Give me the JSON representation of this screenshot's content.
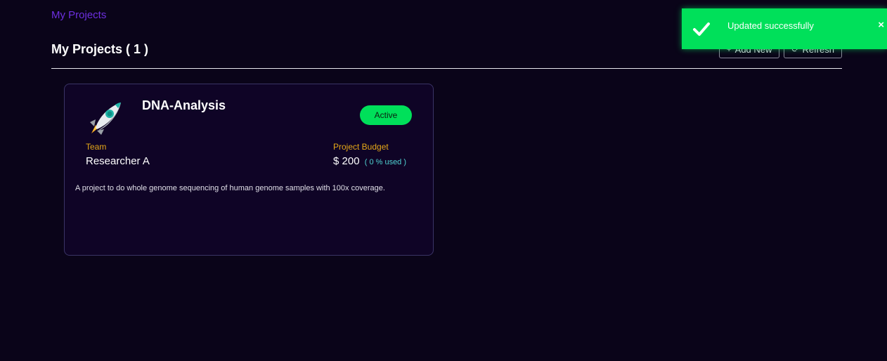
{
  "breadcrumb": {
    "label": "My Projects"
  },
  "header": {
    "title": "My Projects ( 1 )",
    "add_new_label": "Add New",
    "refresh_label": "Refresh"
  },
  "project": {
    "name": "DNA-Analysis",
    "status": "Active",
    "icon": "rocket-icon",
    "team_label": "Team",
    "team_value": "Researcher A",
    "budget_label": "Project Budget",
    "budget_value": "$ 200",
    "budget_used": "( 0 % used )",
    "description": "A project to do whole genome sequencing of human genome samples with 100x coverage."
  },
  "toast": {
    "message": "Updated successfully",
    "close_label": "×",
    "icon": "checkmark-icon"
  },
  "colors": {
    "background": "#0a0419",
    "accent": "#6d2fe0",
    "status_active": "#00e05a",
    "label": "#e6a817",
    "budget_used": "#4fd2d2"
  }
}
